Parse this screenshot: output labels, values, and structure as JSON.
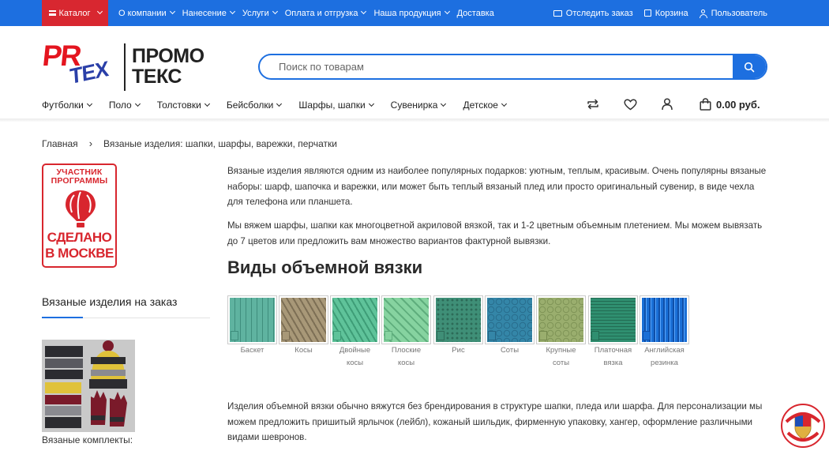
{
  "topbar": {
    "catalog_label": "Каталог",
    "nav": [
      "О компании",
      "Нанесение",
      "Услуги",
      "Оплата и отгрузка",
      "Наша продукция",
      "Доставка"
    ],
    "track_label": "Отследить заказ",
    "cart_label": "Корзина",
    "user_label": "Пользователь"
  },
  "logo": {
    "pr": "PR",
    "tex": "TEX",
    "line1": "ПРОМО",
    "line2": "ТЕКС"
  },
  "search": {
    "placeholder": "Поиск по товарам"
  },
  "main_nav": [
    "Футболки",
    "Поло",
    "Толстовки",
    "Бейсболки",
    "Шарфы, шапки",
    "Сувенирка",
    "Детское"
  ],
  "cart": {
    "total": "0.00 руб."
  },
  "breadcrumb": {
    "home": "Главная",
    "current": "Вязаные изделия: шапки, шарфы, варежки, перчатки"
  },
  "badge": {
    "line1": "УЧАСТНИК",
    "line2": "ПРОГРАММЫ",
    "line3": "СДЕЛАНО",
    "line4": "В МОСКВЕ"
  },
  "sidebar": {
    "title": "Вязаные изделия на заказ",
    "caption": "Вязаные комплекты:"
  },
  "content": {
    "p1": "Вязаные изделия являются одним из наиболее популярных подарков: уютным, теплым, красивым. Очень популярны вязаные наборы: шарф, шапочка и варежки, или может быть теплый вязаный плед или просто оригинальный сувенир, в виде чехла для телефона или планшета.",
    "p2": "Мы вяжем шарфы, шапки как многоцветной акриловой вязкой, так и 1-2 цветным объемным плетением. Мы можем вывязать до 7 цветов или предложить вам множество вариантов фактурной вывязки.",
    "heading": "Виды объемной вязки",
    "p3": "Изделия объемной вязки обычно вяжутся без брендирования в структуре шапки, пледа или шарфа. Для персонализации мы можем предложить пришитый ярлычок (лейбл), кожаный шильдик, фирменную упаковку, хангер, оформление различными видами шевронов."
  },
  "swatches": [
    {
      "label1": "Баскет",
      "label2": "",
      "color": "#5fb3a0",
      "dark": "#3f8e7d",
      "pattern": "weave"
    },
    {
      "label1": "Косы",
      "label2": "",
      "color": "#a89878",
      "dark": "#7d6f55",
      "pattern": "cable"
    },
    {
      "label1": "Двойные",
      "label2": "косы",
      "color": "#5fc39a",
      "dark": "#3e9d77",
      "pattern": "cable"
    },
    {
      "label1": "Плоские",
      "label2": "косы",
      "color": "#86d3a0",
      "dark": "#5fae7d",
      "pattern": "flat"
    },
    {
      "label1": "Рис",
      "label2": "",
      "color": "#3f8f77",
      "dark": "#2d6b58",
      "pattern": "rice"
    },
    {
      "label1": "Соты",
      "label2": "",
      "color": "#3486a8",
      "dark": "#246483",
      "pattern": "honey"
    },
    {
      "label1": "Крупные",
      "label2": "соты",
      "color": "#9aae6e",
      "dark": "#758a4e",
      "pattern": "honey"
    },
    {
      "label1": "Платочная",
      "label2": "вязка",
      "color": "#2f8f70",
      "dark": "#226b52",
      "pattern": "garter"
    },
    {
      "label1": "Английская",
      "label2": "резинка",
      "color": "#1a6fd6",
      "dark": "#0f4fa8",
      "pattern": "rib"
    }
  ]
}
